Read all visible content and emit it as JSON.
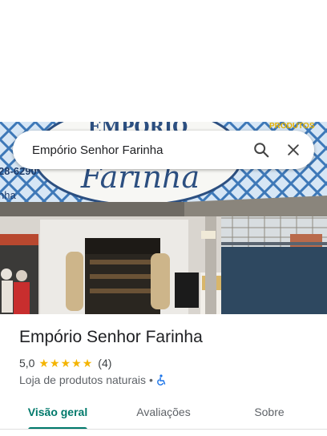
{
  "search": {
    "value": "Empório Senhor Farinha"
  },
  "hero_sign": {
    "top_text": "EMPÓRIO",
    "main_text": "Farinha",
    "right_text": "PRODUTOS",
    "phone_fragment": "28-6290",
    "left_fragment": "nha"
  },
  "place": {
    "name": "Empório Senhor Farinha",
    "rating": "5,0",
    "stars": 5,
    "review_count": "(4)",
    "category": "Loja de produtos naturais",
    "separator": "•"
  },
  "tabs": [
    {
      "label": "Visão geral",
      "active": true
    },
    {
      "label": "Avaliações",
      "active": false
    },
    {
      "label": "Sobre",
      "active": false
    }
  ],
  "colors": {
    "accent": "#00796b",
    "star": "#f4b400",
    "accessibility": "#1a73e8"
  },
  "icons": {
    "search": "search-icon",
    "close": "close-icon",
    "accessibility": "wheelchair-icon"
  }
}
